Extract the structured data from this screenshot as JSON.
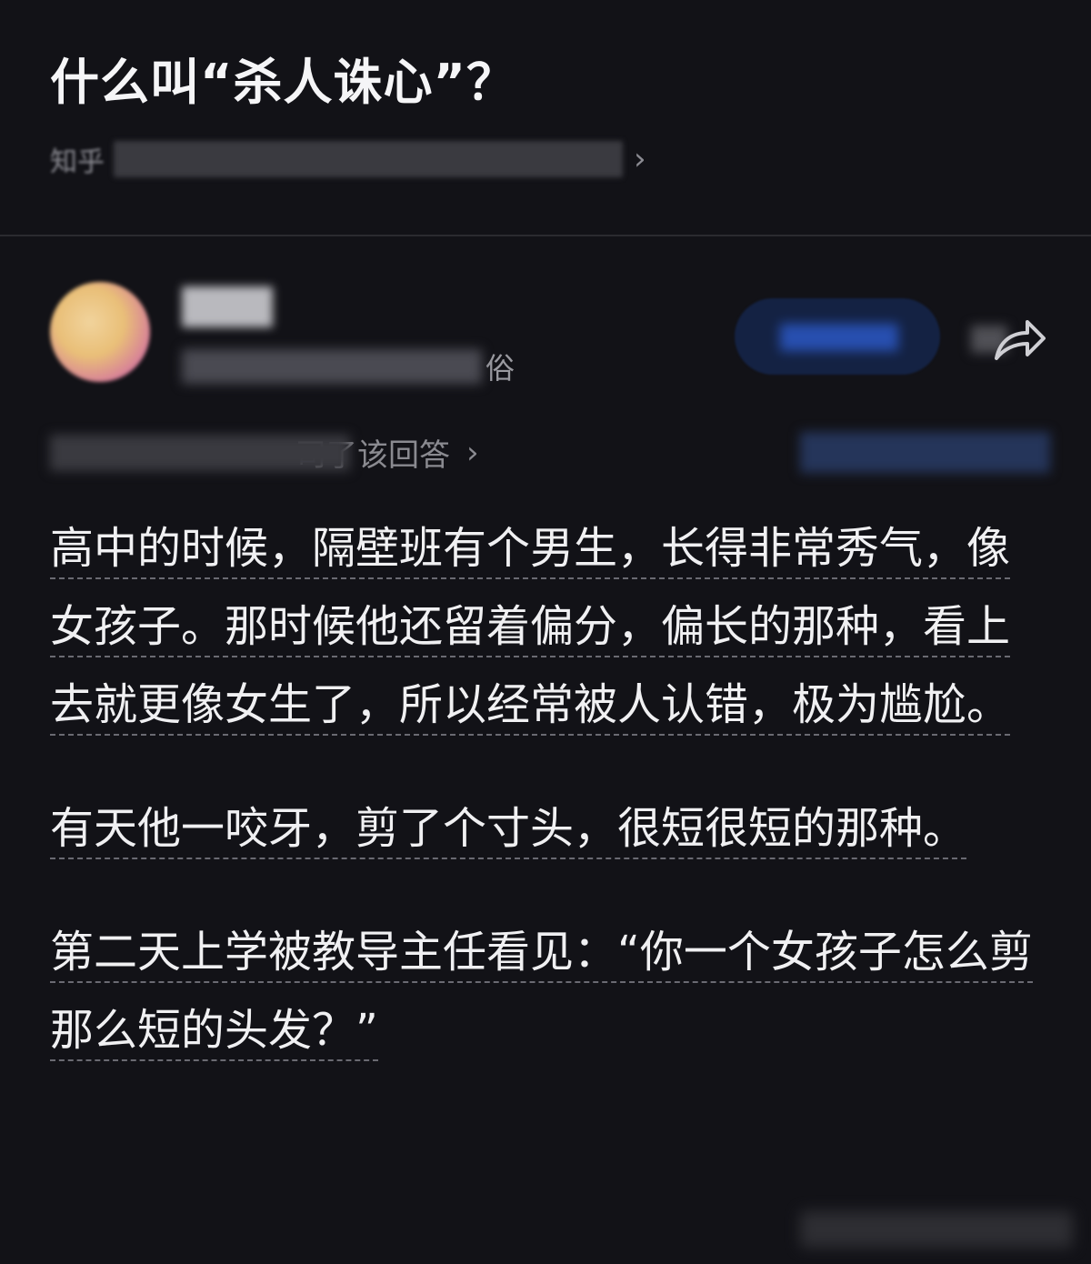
{
  "question": {
    "title": "什么叫“杀人诛心”？"
  },
  "source": {
    "prefix": "知乎",
    "chevron": "›"
  },
  "author": {
    "bio_suffix": "俗",
    "follow_button_color": "#2e5ed4",
    "share_icon": "share-icon"
  },
  "stats": {
    "label": "司了该回答",
    "chevron": "›"
  },
  "content": {
    "paragraphs": [
      "高中的时候，隔壁班有个男生，长得非常秀气，像女孩子。那时候他还留着偏分，偏长的那种，看上去就更像女生了，所以经常被人认错，极为尴尬。",
      "有天他一咬牙，剪了个寸头，很短很短的那种。",
      "第二天上学被教导主任看见：“你一个女孩子怎么剪那么短的头发？”"
    ]
  },
  "colors": {
    "background": "#121217",
    "text": "#f0f0f2",
    "muted": "#8b8b92",
    "accent": "#2e5ed4"
  }
}
